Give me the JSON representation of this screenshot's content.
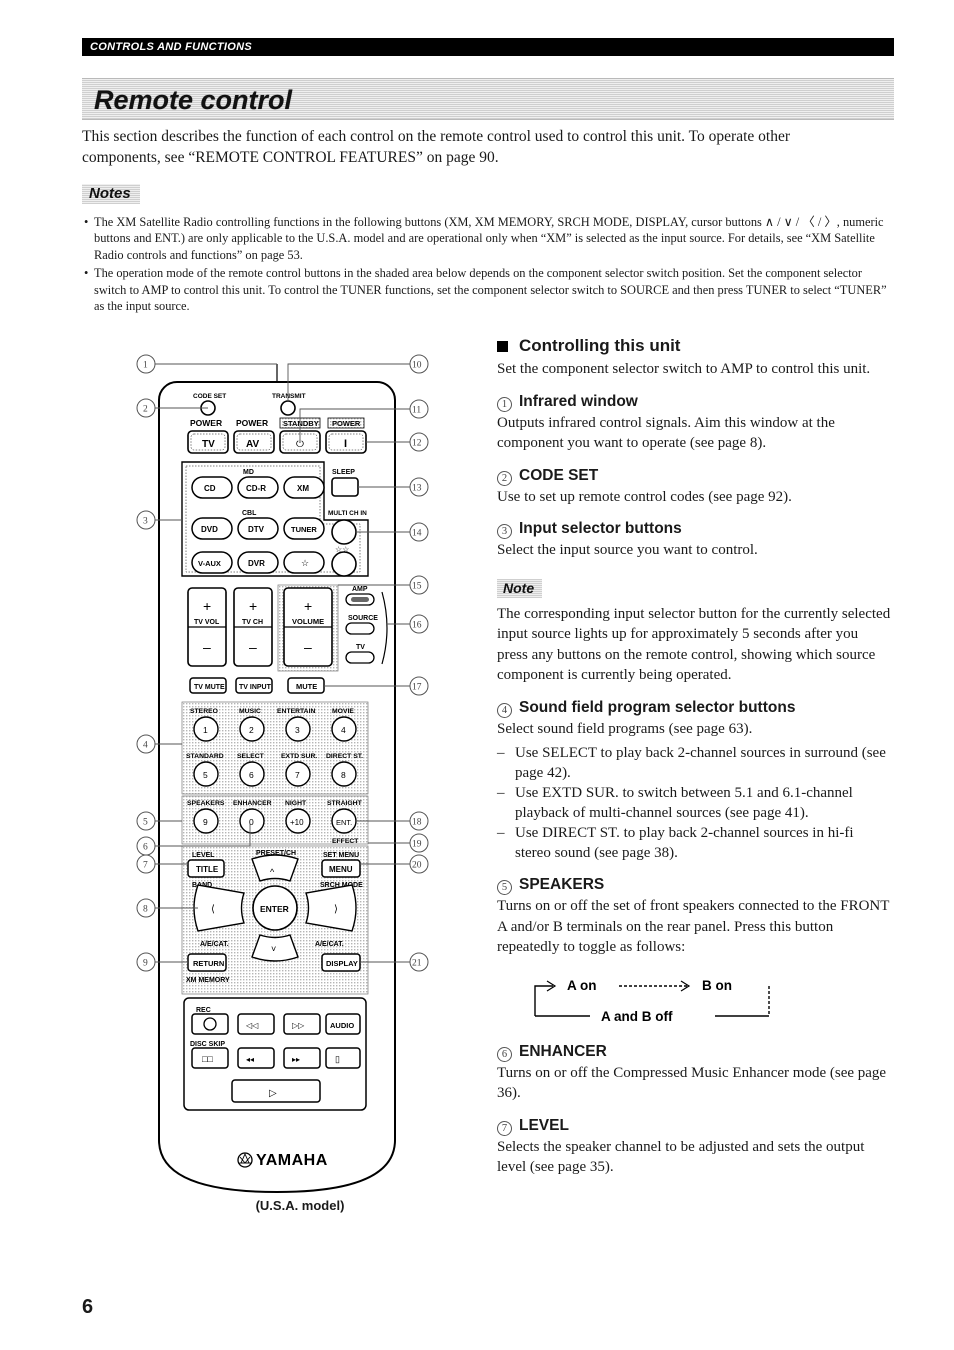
{
  "header": {
    "running_head": "CONTROLS AND FUNCTIONS",
    "section_title": "Remote control"
  },
  "intro": "This section describes the function of each control on the remote control used to control this unit. To operate other components, see “REMOTE CONTROL FEATURES” on page 90.",
  "notes": {
    "label": "Notes",
    "items": [
      "The XM Satellite Radio controlling functions in the following buttons (XM, XM MEMORY, SRCH MODE, DISPLAY, cursor buttons ∧ / ∨ / 〈 / 〉, numeric buttons and ENT.) are only applicable to the U.S.A. model and are operational only when “XM” is selected as the input source. For details, see “XM Satellite Radio controls and functions” on page 53.",
      "The operation mode of the remote control buttons in the shaded area below depends on the component selector switch position. Set the component selector switch to AMP to control this unit. To control the TUNER functions, set the component selector switch to SOURCE and then press TUNER to select “TUNER” as the input source."
    ]
  },
  "right_column": {
    "heading": "Controlling this unit",
    "heading_intro": "Set the component selector switch to AMP to control this unit.",
    "items": [
      {
        "num": "1",
        "title": "Infrared window",
        "body": "Outputs infrared control signals. Aim this window at the component you want to operate (see page 8)."
      },
      {
        "num": "2",
        "title": "CODE SET",
        "body": "Use to set up remote control codes (see page 92)."
      },
      {
        "num": "3",
        "title": "Input selector buttons",
        "body": "Select the input source you want to control."
      }
    ],
    "note": {
      "label": "Note",
      "body": "The corresponding input selector button for the currently selected input source lights up for approximately 5 seconds after you press any buttons on the remote control, showing which source component is currently being operated."
    },
    "item4": {
      "num": "4",
      "title": "Sound field program selector buttons",
      "body": "Select sound field programs (see page 63).",
      "bullets": [
        "Use SELECT to play back 2-channel sources in surround (see page 42).",
        "Use EXTD SUR. to switch between 5.1 and 6.1-channel playback of multi-channel sources (see page 41).",
        "Use DIRECT ST. to play back 2-channel sources in hi-fi stereo sound (see page 38)."
      ]
    },
    "item5": {
      "num": "5",
      "title": "SPEAKERS",
      "body": "Turns on or off the set of front speakers connected to the FRONT A and/or B terminals on the rear panel. Press this button repeatedly to toggle as follows:",
      "diagram": {
        "a_on": "A on",
        "b_on": "B on",
        "ab_off": "A and B off"
      }
    },
    "item6": {
      "num": "6",
      "title": "ENHANCER",
      "body": "Turns on or off the Compressed Music Enhancer mode (see page 36)."
    },
    "item7": {
      "num": "7",
      "title": "LEVEL",
      "body": "Selects the speaker channel to be adjusted and sets the output level (see page 35)."
    }
  },
  "figure": {
    "caption": "(U.S.A. model)",
    "brand": "YAMAHA",
    "labels": {
      "code_set": "CODE SET",
      "transmit": "TRANSMIT",
      "power_tv_top": "POWER",
      "power_av_top": "POWER",
      "standby_top": "STANDBY",
      "power_top": "POWER",
      "tv": "TV",
      "av": "AV",
      "standby_glyph": "⏻",
      "power_glyph": "I",
      "md": "MD",
      "cbl": "CBL",
      "cd": "CD",
      "cdr": "CD-R",
      "xm": "XM",
      "dvd": "DVD",
      "dtv": "DTV",
      "tuner": "TUNER",
      "vaux": "V-AUX",
      "dvr": "DVR",
      "star1": "☆",
      "star2": "☆☆",
      "sleep": "SLEEP",
      "multi_ch_in": "MULTI CH IN",
      "tv_vol": "TV VOL",
      "tv_ch": "TV CH",
      "volume": "VOLUME",
      "plus": "+",
      "minus": "–",
      "amp": "AMP",
      "source": "SOURCE",
      "tv_switch": "TV",
      "tv_mute": "TV MUTE",
      "tv_input": "TV INPUT",
      "mute": "MUTE",
      "stereo": "STEREO",
      "music": "MUSIC",
      "entertain": "ENTERTAIN",
      "movie": "MOVIE",
      "standard": "STANDARD",
      "select": "SELECT",
      "extd_sur": "EXTD SUR.",
      "direct_st": "DIRECT ST.",
      "speakers": "SPEAKERS",
      "enhancer": "ENHANCER",
      "night": "NIGHT",
      "straight": "STRAIGHT",
      "effect": "EFFECT",
      "ent": "ENT.",
      "n1": "1",
      "n2": "2",
      "n3": "3",
      "n4": "4",
      "n5": "5",
      "n6": "6",
      "n7": "7",
      "n8": "8",
      "n9": "9",
      "n0": "0",
      "n10": "+10",
      "level": "LEVEL",
      "title": "TITLE",
      "band": "BAND",
      "preset_ch": "PRESET/CH",
      "set_menu": "SET MENU",
      "menu": "MENU",
      "srch_mode": "SRCH MODE",
      "enter": "ENTER",
      "ae_cat_l": "A/E/CAT.",
      "ae_cat_r": "A/E/CAT.",
      "return": "RETURN",
      "xm_memory": "XM MEMORY",
      "display": "DISPLAY",
      "rec": "REC",
      "disc_skip": "DISC SKIP",
      "audio": "AUDIO",
      "cur_up": "∨",
      "cur_down": "∨",
      "cur_left": "〈",
      "cur_right": "〉"
    },
    "callouts": [
      "1",
      "2",
      "3",
      "4",
      "5",
      "6",
      "7",
      "8",
      "9",
      "10",
      "11",
      "12",
      "13",
      "14",
      "15",
      "16",
      "17",
      "18",
      "19",
      "20",
      "21"
    ]
  },
  "footer": {
    "page_number": "6"
  }
}
